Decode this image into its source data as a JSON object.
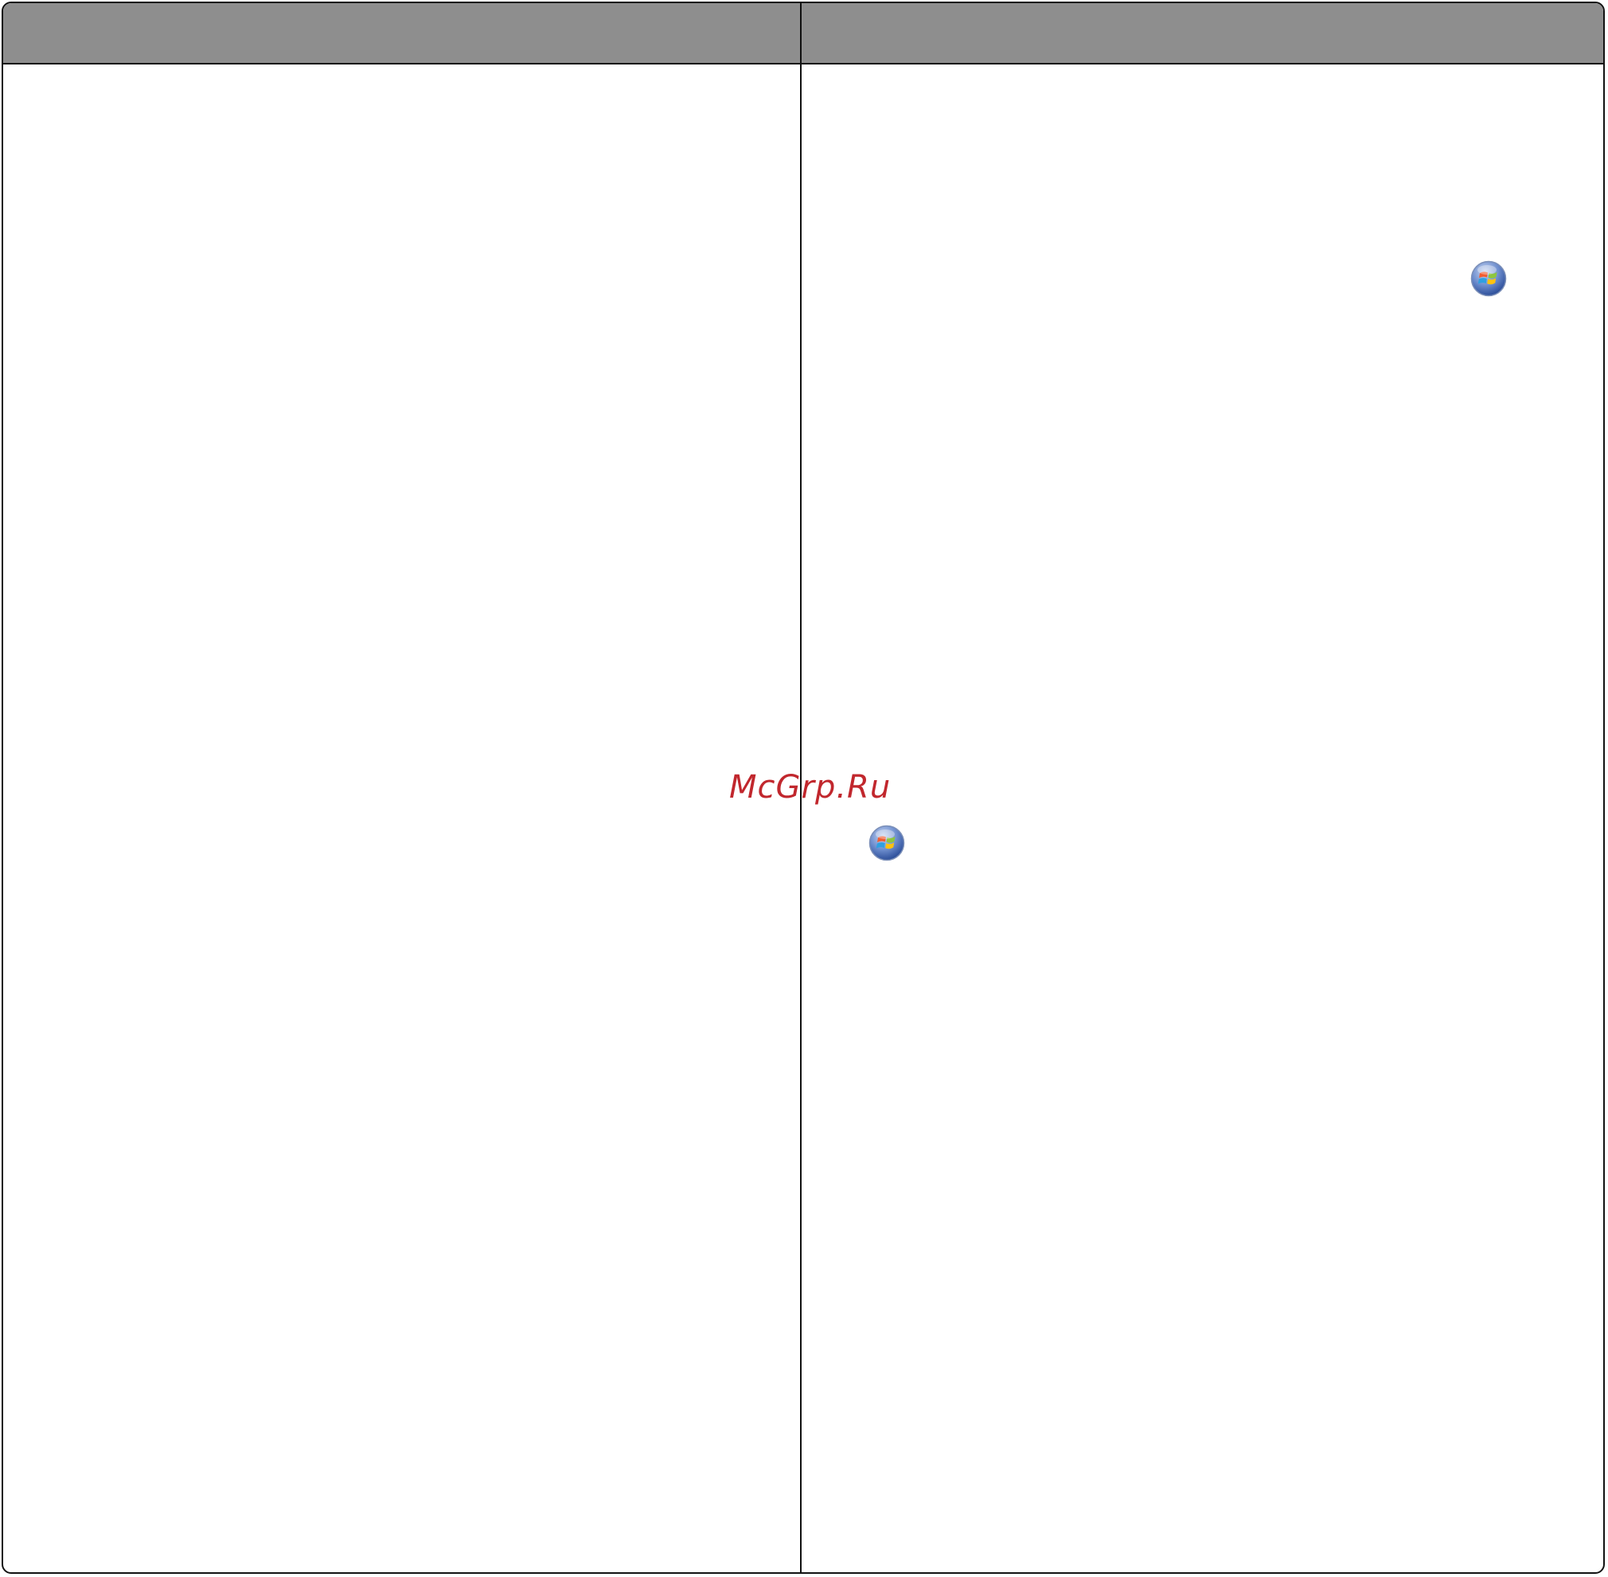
{
  "table": {
    "columns": [
      {
        "header": "",
        "body": ""
      },
      {
        "header": "",
        "body": ""
      }
    ]
  },
  "icons": [
    {
      "name": "windows-start-icon"
    },
    {
      "name": "windows-start-icon"
    }
  ],
  "watermark": {
    "text": "McGrp.Ru",
    "color": "#c1272d"
  },
  "colors": {
    "header_background": "#8e8e8e",
    "border": "#111111"
  }
}
